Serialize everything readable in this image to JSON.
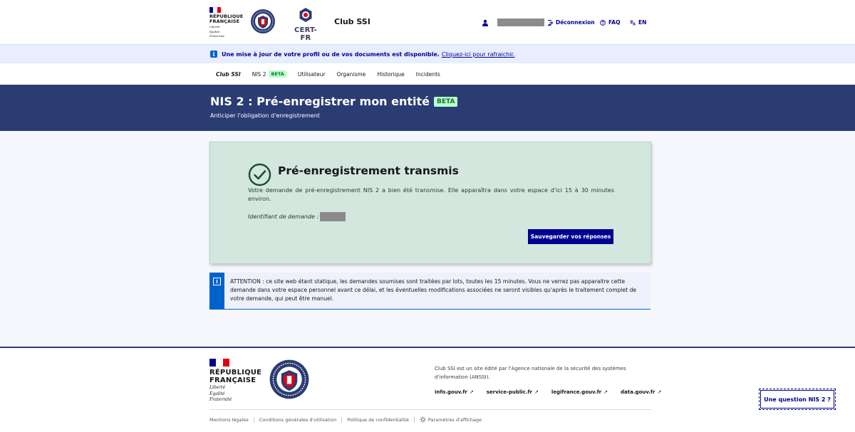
{
  "colors": {
    "primary": "#000091",
    "banner": "#2b3c73",
    "success_bg": "#d3e7de",
    "info": "#0063cb",
    "beta_bg": "#b8fec9",
    "beta_text": "#18753c",
    "flag_blue": "#000091",
    "flag_white": "#ffffff",
    "flag_red": "#e1000f"
  },
  "header": {
    "gov_logo_lines": [
      "RÉPUBLIQUE",
      "FRANÇAISE"
    ],
    "gov_motto": [
      "Liberté",
      "Égalité",
      "Fraternité"
    ],
    "cert_label": "CERT-FR",
    "service_title": "Club SSI",
    "logout": "Déconnexion",
    "faq": "FAQ",
    "lang": "EN"
  },
  "notice": {
    "text": "Une mise à jour de votre profil ou de vos documents est disponible.",
    "link": "Cliquez-ici pour rafraichir."
  },
  "nav": {
    "items": [
      {
        "label": "Club SSI",
        "current": true
      },
      {
        "label": "NIS 2",
        "badge": "BETA"
      },
      {
        "label": "Utilisateur"
      },
      {
        "label": "Organisme"
      },
      {
        "label": "Historique"
      },
      {
        "label": "Incidents"
      }
    ]
  },
  "banner": {
    "title": "NIS 2 : Pré-enregistrer mon entité",
    "badge": "BETA",
    "subtitle": "Anticiper l'obligation d'enregistrement"
  },
  "success": {
    "title": "Pré-enregistrement transmis",
    "text": "Votre demande de pré-enregistrement NIS 2 a bien été transmise. Elle apparaîtra dans votre espace d'ici 15 à 30 minutes environ.",
    "id_label": "Identifiant de demande :",
    "save_button": "Sauvegarder vos réponses"
  },
  "warning": {
    "text": "ATTENTION : ce site web étant statique, les demandes soumises sont traitées par lots, toutes les 15 minutes. Vous ne verrez pas apparaitre cette demande dans votre espace personnel avant ce délai, et les éventuelles modifications associées ne seront visibles qu'après le traitement complet de votre demande, qui peut être manuel."
  },
  "footer": {
    "gov_logo_lines": [
      "RÉPUBLIQUE",
      "FRANÇAISE"
    ],
    "gov_motto": [
      "Liberté",
      "Égalité",
      "Fraternité"
    ],
    "description": "Club SSI est un site édité par l'Agence nationale de la sécurité des systèmes d'information (ANSSI).",
    "links": [
      "info.gouv.fr",
      "service-public.fr",
      "legifrance.gouv.fr",
      "data.gouv.fr"
    ],
    "bottom_links": [
      "Mentions légales",
      "Conditions générales d'utilisation",
      "Politique de confidentialité",
      "Paramètres d'affichage"
    ],
    "question_button": "Une question NIS 2 ?"
  }
}
